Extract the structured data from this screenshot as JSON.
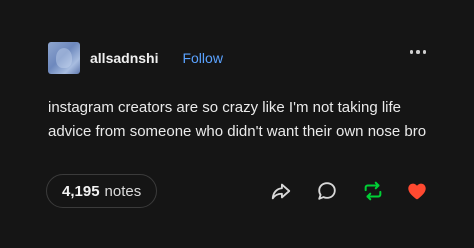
{
  "post": {
    "username": "allsadnshi",
    "follow_label": "Follow",
    "text": "instagram creators are so crazy like I'm not taking life advice from someone who didn't want their own nose bro",
    "notes_count": "4,195",
    "notes_label": "notes"
  },
  "icons": {
    "more": "more-options-icon",
    "share": "share-icon",
    "reply": "reply-icon",
    "reblog": "reblog-icon",
    "like": "heart-icon"
  },
  "colors": {
    "background": "#151515",
    "follow": "#5aa2ff",
    "reblog": "#00cf35",
    "like": "#ff4930"
  }
}
